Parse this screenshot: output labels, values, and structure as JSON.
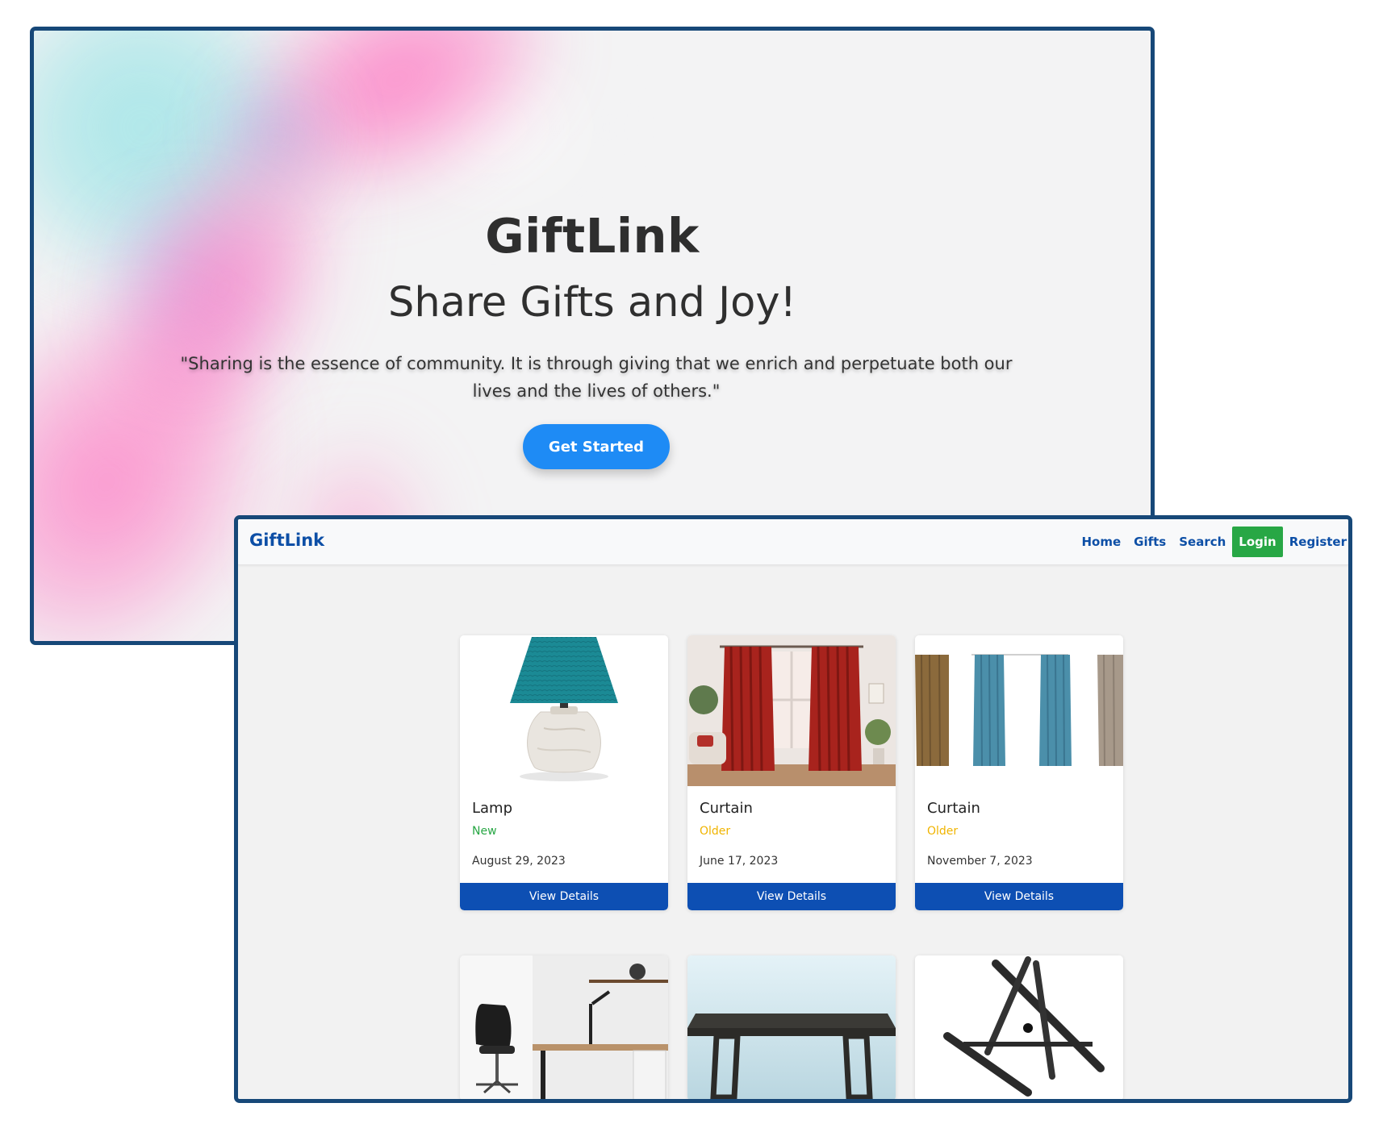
{
  "landing": {
    "title": "GiftLink",
    "subtitle": "Share Gifts and Joy!",
    "quote": "\"Sharing is the essence of community. It is through giving that we enrich and perpetuate both our lives and the lives of others.\"",
    "cta_label": "Get Started"
  },
  "navbar": {
    "brand": "GiftLink",
    "links": {
      "home": "Home",
      "gifts": "Gifts",
      "search": "Search",
      "login": "Login",
      "register": "Register"
    }
  },
  "gifts": [
    {
      "name": "Lamp",
      "condition": "New",
      "date": "August 29, 2023",
      "button": "View Details",
      "image": "lamp-image"
    },
    {
      "name": "Curtain",
      "condition": "Older",
      "date": "June 17, 2023",
      "button": "View Details",
      "image": "red-curtain-image"
    },
    {
      "name": "Curtain",
      "condition": "Older",
      "date": "November 7, 2023",
      "button": "View Details",
      "image": "curtain-set-image"
    },
    {
      "image": "office-desk-image"
    },
    {
      "image": "table-image"
    },
    {
      "image": "laptop-stand-image"
    }
  ],
  "colors": {
    "window_border": "#174878",
    "brand_blue": "#0d4fa6",
    "cta_blue": "#1e8bf5",
    "button_blue": "#0d4fb3",
    "login_green": "#28a745",
    "condition_new": "#28a745",
    "condition_older": "#f0b400"
  }
}
